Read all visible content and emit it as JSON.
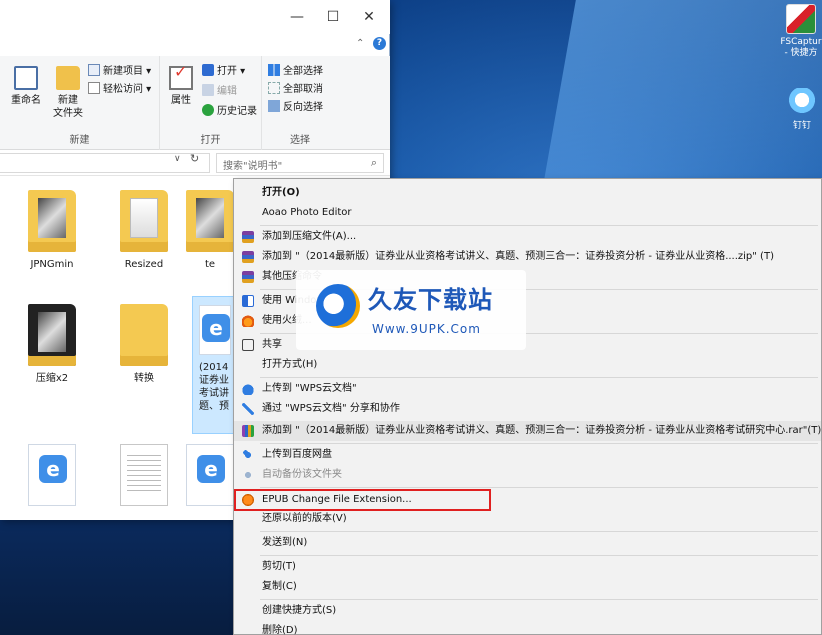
{
  "desktop": {
    "icons": [
      {
        "label_line1": "FSCaptur",
        "label_line2": "- 快捷方"
      },
      {
        "label_line1": "钉钉"
      }
    ]
  },
  "window": {
    "controls": {
      "minimize": "—",
      "maximize": "☐",
      "close": "✕"
    },
    "help": "?"
  },
  "ribbon": {
    "rename": "重命名",
    "new_folder_line1": "新建",
    "new_folder_line2": "文件夹",
    "new_item": "新建项目 ▾",
    "easy_access": "轻松访问 ▾",
    "group_new": "新建",
    "properties": "属性",
    "open": "打开 ▾",
    "edit": "编辑",
    "history": "历史记录",
    "group_open": "打开",
    "select_all": "全部选择",
    "select_none": "全部取消",
    "invert_selection": "反向选择",
    "group_select": "选择"
  },
  "address": {
    "search_placeholder": "搜索\"说明书\""
  },
  "files": [
    {
      "label": "JPNGmin"
    },
    {
      "label": "Resized"
    },
    {
      "label": "te"
    },
    {
      "label": "压缩x2"
    },
    {
      "label": "转换"
    },
    {
      "label_lines": [
        "(2014",
        "证券业",
        "考试讲",
        "题、预"
      ]
    }
  ],
  "context_menu": {
    "items": [
      {
        "label": "打开(O)"
      },
      {
        "label": "Aoao Photo Editor"
      },
      {
        "label": "添加到压缩文件(A)..."
      },
      {
        "label": "添加到 \"（2014最新版）证券业从业资格考试讲义、真题、预测三合一：证券投资分析 - 证券业从业资格....zip\" (T)"
      },
      {
        "label": "其他压缩命令"
      },
      {
        "label": "使用 Windows"
      },
      {
        "label": "使用火绒..."
      },
      {
        "label": "共享"
      },
      {
        "label": "打开方式(H)"
      },
      {
        "label": "上传到 \"WPS云文档\""
      },
      {
        "label": "通过 \"WPS云文档\" 分享和协作"
      },
      {
        "label": "添加到 \"（2014最新版）证券业从业资格考试讲义、真题、预测三合一：证券投资分析 - 证券业从业资格考试研究中心.rar\"(T)"
      },
      {
        "label": "上传到百度网盘"
      },
      {
        "label": "自动备份该文件夹"
      },
      {
        "label": "EPUB   Change File Extension..."
      },
      {
        "label": "还原以前的版本(V)"
      },
      {
        "label": "发送到(N)"
      },
      {
        "label": "剪切(T)"
      },
      {
        "label": "复制(C)"
      },
      {
        "label": "创建快捷方式(S)"
      },
      {
        "label": "删除(D)"
      }
    ]
  },
  "watermark": {
    "title": "久友下载站",
    "url": "Www.9UPK.Com"
  }
}
